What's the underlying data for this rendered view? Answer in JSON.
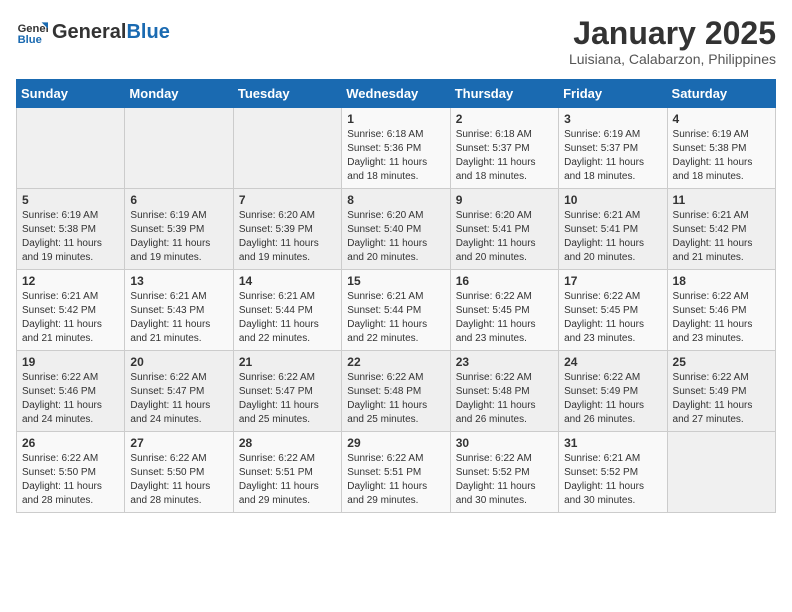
{
  "header": {
    "logo_general": "General",
    "logo_blue": "Blue",
    "title": "January 2025",
    "subtitle": "Luisiana, Calabarzon, Philippines"
  },
  "weekdays": [
    "Sunday",
    "Monday",
    "Tuesday",
    "Wednesday",
    "Thursday",
    "Friday",
    "Saturday"
  ],
  "weeks": [
    [
      {
        "day": "",
        "info": ""
      },
      {
        "day": "",
        "info": ""
      },
      {
        "day": "",
        "info": ""
      },
      {
        "day": "1",
        "sunrise": "Sunrise: 6:18 AM",
        "sunset": "Sunset: 5:36 PM",
        "daylight": "Daylight: 11 hours and 18 minutes."
      },
      {
        "day": "2",
        "sunrise": "Sunrise: 6:18 AM",
        "sunset": "Sunset: 5:37 PM",
        "daylight": "Daylight: 11 hours and 18 minutes."
      },
      {
        "day": "3",
        "sunrise": "Sunrise: 6:19 AM",
        "sunset": "Sunset: 5:37 PM",
        "daylight": "Daylight: 11 hours and 18 minutes."
      },
      {
        "day": "4",
        "sunrise": "Sunrise: 6:19 AM",
        "sunset": "Sunset: 5:38 PM",
        "daylight": "Daylight: 11 hours and 18 minutes."
      }
    ],
    [
      {
        "day": "5",
        "sunrise": "Sunrise: 6:19 AM",
        "sunset": "Sunset: 5:38 PM",
        "daylight": "Daylight: 11 hours and 19 minutes."
      },
      {
        "day": "6",
        "sunrise": "Sunrise: 6:19 AM",
        "sunset": "Sunset: 5:39 PM",
        "daylight": "Daylight: 11 hours and 19 minutes."
      },
      {
        "day": "7",
        "sunrise": "Sunrise: 6:20 AM",
        "sunset": "Sunset: 5:39 PM",
        "daylight": "Daylight: 11 hours and 19 minutes."
      },
      {
        "day": "8",
        "sunrise": "Sunrise: 6:20 AM",
        "sunset": "Sunset: 5:40 PM",
        "daylight": "Daylight: 11 hours and 20 minutes."
      },
      {
        "day": "9",
        "sunrise": "Sunrise: 6:20 AM",
        "sunset": "Sunset: 5:41 PM",
        "daylight": "Daylight: 11 hours and 20 minutes."
      },
      {
        "day": "10",
        "sunrise": "Sunrise: 6:21 AM",
        "sunset": "Sunset: 5:41 PM",
        "daylight": "Daylight: 11 hours and 20 minutes."
      },
      {
        "day": "11",
        "sunrise": "Sunrise: 6:21 AM",
        "sunset": "Sunset: 5:42 PM",
        "daylight": "Daylight: 11 hours and 21 minutes."
      }
    ],
    [
      {
        "day": "12",
        "sunrise": "Sunrise: 6:21 AM",
        "sunset": "Sunset: 5:42 PM",
        "daylight": "Daylight: 11 hours and 21 minutes."
      },
      {
        "day": "13",
        "sunrise": "Sunrise: 6:21 AM",
        "sunset": "Sunset: 5:43 PM",
        "daylight": "Daylight: 11 hours and 21 minutes."
      },
      {
        "day": "14",
        "sunrise": "Sunrise: 6:21 AM",
        "sunset": "Sunset: 5:44 PM",
        "daylight": "Daylight: 11 hours and 22 minutes."
      },
      {
        "day": "15",
        "sunrise": "Sunrise: 6:21 AM",
        "sunset": "Sunset: 5:44 PM",
        "daylight": "Daylight: 11 hours and 22 minutes."
      },
      {
        "day": "16",
        "sunrise": "Sunrise: 6:22 AM",
        "sunset": "Sunset: 5:45 PM",
        "daylight": "Daylight: 11 hours and 23 minutes."
      },
      {
        "day": "17",
        "sunrise": "Sunrise: 6:22 AM",
        "sunset": "Sunset: 5:45 PM",
        "daylight": "Daylight: 11 hours and 23 minutes."
      },
      {
        "day": "18",
        "sunrise": "Sunrise: 6:22 AM",
        "sunset": "Sunset: 5:46 PM",
        "daylight": "Daylight: 11 hours and 23 minutes."
      }
    ],
    [
      {
        "day": "19",
        "sunrise": "Sunrise: 6:22 AM",
        "sunset": "Sunset: 5:46 PM",
        "daylight": "Daylight: 11 hours and 24 minutes."
      },
      {
        "day": "20",
        "sunrise": "Sunrise: 6:22 AM",
        "sunset": "Sunset: 5:47 PM",
        "daylight": "Daylight: 11 hours and 24 minutes."
      },
      {
        "day": "21",
        "sunrise": "Sunrise: 6:22 AM",
        "sunset": "Sunset: 5:47 PM",
        "daylight": "Daylight: 11 hours and 25 minutes."
      },
      {
        "day": "22",
        "sunrise": "Sunrise: 6:22 AM",
        "sunset": "Sunset: 5:48 PM",
        "daylight": "Daylight: 11 hours and 25 minutes."
      },
      {
        "day": "23",
        "sunrise": "Sunrise: 6:22 AM",
        "sunset": "Sunset: 5:48 PM",
        "daylight": "Daylight: 11 hours and 26 minutes."
      },
      {
        "day": "24",
        "sunrise": "Sunrise: 6:22 AM",
        "sunset": "Sunset: 5:49 PM",
        "daylight": "Daylight: 11 hours and 26 minutes."
      },
      {
        "day": "25",
        "sunrise": "Sunrise: 6:22 AM",
        "sunset": "Sunset: 5:49 PM",
        "daylight": "Daylight: 11 hours and 27 minutes."
      }
    ],
    [
      {
        "day": "26",
        "sunrise": "Sunrise: 6:22 AM",
        "sunset": "Sunset: 5:50 PM",
        "daylight": "Daylight: 11 hours and 28 minutes."
      },
      {
        "day": "27",
        "sunrise": "Sunrise: 6:22 AM",
        "sunset": "Sunset: 5:50 PM",
        "daylight": "Daylight: 11 hours and 28 minutes."
      },
      {
        "day": "28",
        "sunrise": "Sunrise: 6:22 AM",
        "sunset": "Sunset: 5:51 PM",
        "daylight": "Daylight: 11 hours and 29 minutes."
      },
      {
        "day": "29",
        "sunrise": "Sunrise: 6:22 AM",
        "sunset": "Sunset: 5:51 PM",
        "daylight": "Daylight: 11 hours and 29 minutes."
      },
      {
        "day": "30",
        "sunrise": "Sunrise: 6:22 AM",
        "sunset": "Sunset: 5:52 PM",
        "daylight": "Daylight: 11 hours and 30 minutes."
      },
      {
        "day": "31",
        "sunrise": "Sunrise: 6:21 AM",
        "sunset": "Sunset: 5:52 PM",
        "daylight": "Daylight: 11 hours and 30 minutes."
      },
      {
        "day": "",
        "info": ""
      }
    ]
  ]
}
